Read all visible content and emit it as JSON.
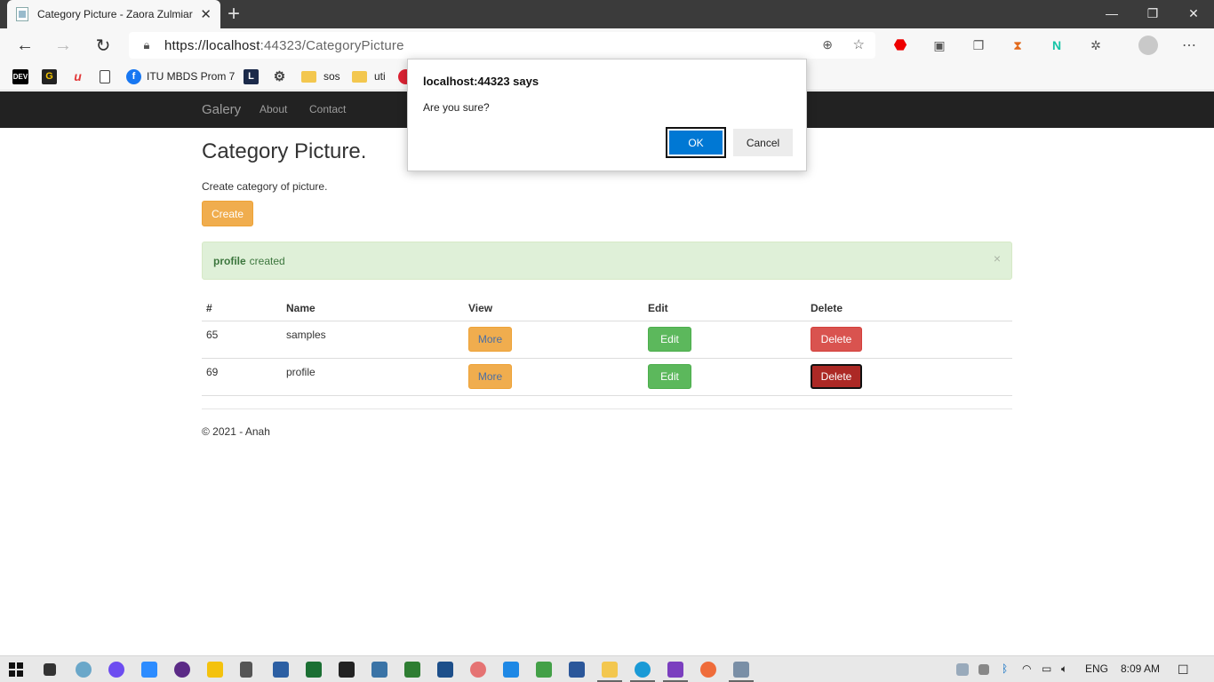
{
  "browser": {
    "tab_title": "Category Picture - Zaora Zulmiar",
    "new_tab": "+",
    "url_host": "https://localhost",
    "url_port_path": ":44323/CategoryPicture",
    "bookmarks": [
      "ITU MBDS Prom 7",
      "sos",
      "uti"
    ],
    "bookmark_badges": [
      "DEV",
      "G",
      "u"
    ]
  },
  "site": {
    "brand": "Galery",
    "nav": [
      "About",
      "Contact"
    ]
  },
  "page": {
    "title": "Category Picture.",
    "subtitle": "Create category of picture.",
    "create_label": "Create",
    "alert_strong": "profile",
    "alert_text": "created",
    "alert_close": "×",
    "columns": [
      "#",
      "Name",
      "View",
      "Edit",
      "Delete"
    ],
    "rows": [
      {
        "id": "65",
        "name": "samples",
        "view": "More",
        "edit": "Edit",
        "delete": "Delete"
      },
      {
        "id": "69",
        "name": "profile",
        "view": "More",
        "edit": "Edit",
        "delete": "Delete"
      }
    ],
    "footer": "© 2021 - Anah"
  },
  "dialog": {
    "title": "localhost:44323 says",
    "message": "Are you sure?",
    "ok": "OK",
    "cancel": "Cancel"
  },
  "taskbar": {
    "language": "ENG",
    "time": "8:09 AM"
  },
  "colors": {
    "navbar": "#222222",
    "warning": "#f0ad4e",
    "success": "#5cb85c",
    "danger": "#d9534f",
    "danger_active": "#ac2925",
    "dialog_ok": "#0078d4",
    "alert_bg": "#dff0d8"
  }
}
